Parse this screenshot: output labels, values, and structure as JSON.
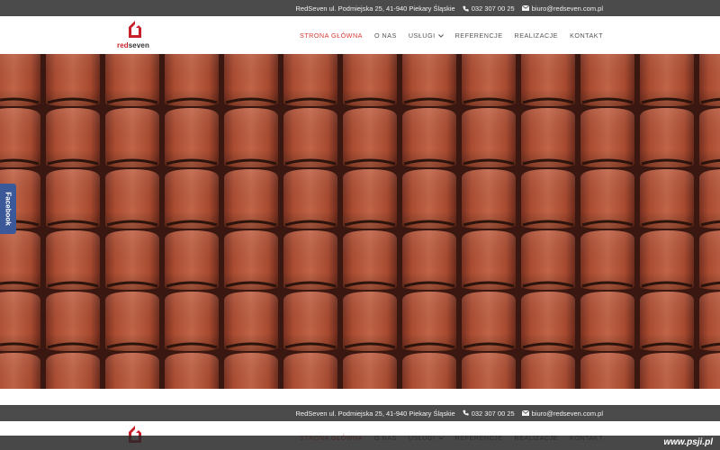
{
  "topbar": {
    "address": "RedSeven ul. Podmiejska 25, 41-940 Piekary Śląskie",
    "phone": "032 307 00 25",
    "email": "biuro@redseven.com.pl"
  },
  "brand": {
    "name_red": "red",
    "name_dark": "seven",
    "accent_color": "#c8202b"
  },
  "nav": {
    "items": [
      {
        "label": "STRONA GŁÓWNA",
        "active": true
      },
      {
        "label": "O NAS"
      },
      {
        "label": "USŁUGI",
        "dropdown": true
      },
      {
        "label": "REFERENCJE"
      },
      {
        "label": "REALIZACJE"
      },
      {
        "label": "KONTAKT"
      }
    ]
  },
  "hero": {
    "image": "roof-tiles-photo",
    "slides_total": 4,
    "slide_active": 2
  },
  "side_tab": {
    "label": "Facebook",
    "color": "#3b5998"
  },
  "watermark": "www.psji.pl",
  "icons": {
    "phone": "phone-icon",
    "email": "envelope-icon",
    "dropdown": "chevron-down-icon"
  }
}
